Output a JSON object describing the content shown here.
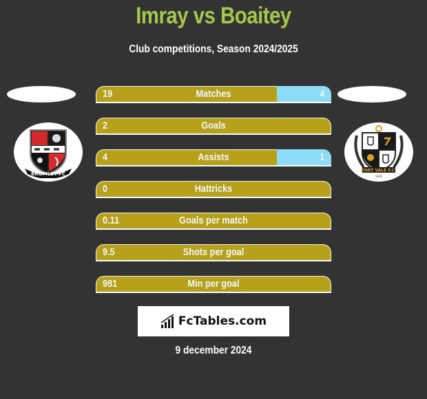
{
  "header": {
    "title": "Imray vs Boaitey",
    "subtitle": "Club competitions, Season 2024/2025"
  },
  "teams": {
    "left": {
      "name": "Bromley FC",
      "logo_icon": "bromley-fc-crest-icon"
    },
    "right": {
      "name": "Port Vale F.C.",
      "logo_icon": "port-vale-fc-crest-icon"
    }
  },
  "colors": {
    "title": "#a6c84a",
    "left_bar": "#b8a11a",
    "right_bar": "#8ddcf7",
    "background": "#333333"
  },
  "stats": [
    {
      "label": "Matches",
      "left": "19",
      "right": "4",
      "right_share": 0.23
    },
    {
      "label": "Goals",
      "left": "2",
      "right": "",
      "right_share": 0
    },
    {
      "label": "Assists",
      "left": "4",
      "right": "1",
      "right_share": 0.23
    },
    {
      "label": "Hattricks",
      "left": "0",
      "right": "",
      "right_share": 0
    },
    {
      "label": "Goals per match",
      "left": "0.11",
      "right": "",
      "right_share": 0
    },
    {
      "label": "Shots per goal",
      "left": "9.5",
      "right": "",
      "right_share": 0
    },
    {
      "label": "Min per goal",
      "left": "981",
      "right": "",
      "right_share": 0
    }
  ],
  "brand": {
    "text": "FcTables.com",
    "icon": "bar-chart-icon"
  },
  "date": "9 december 2024"
}
